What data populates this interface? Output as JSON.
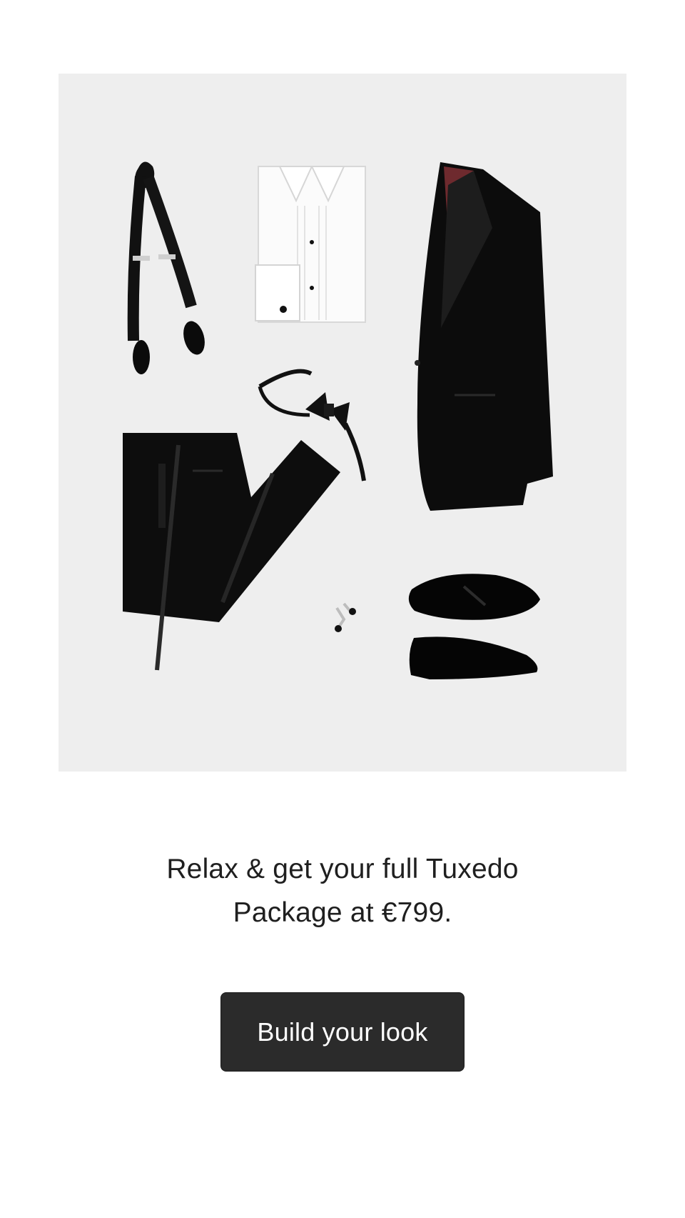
{
  "hero": {
    "image_subject": "tuxedo-package-flat-lay",
    "items": [
      "suspenders",
      "tuxedo-shirt",
      "tuxedo-jacket",
      "bow-tie",
      "tuxedo-trousers",
      "cufflinks",
      "patent-leather-shoes"
    ],
    "background_color": "#eeeeee"
  },
  "promo": {
    "line1": "Relax & get your full Tuxedo",
    "line2": "Package at €799."
  },
  "cta": {
    "label": "Build your look",
    "background_color": "#2b2b2b"
  }
}
